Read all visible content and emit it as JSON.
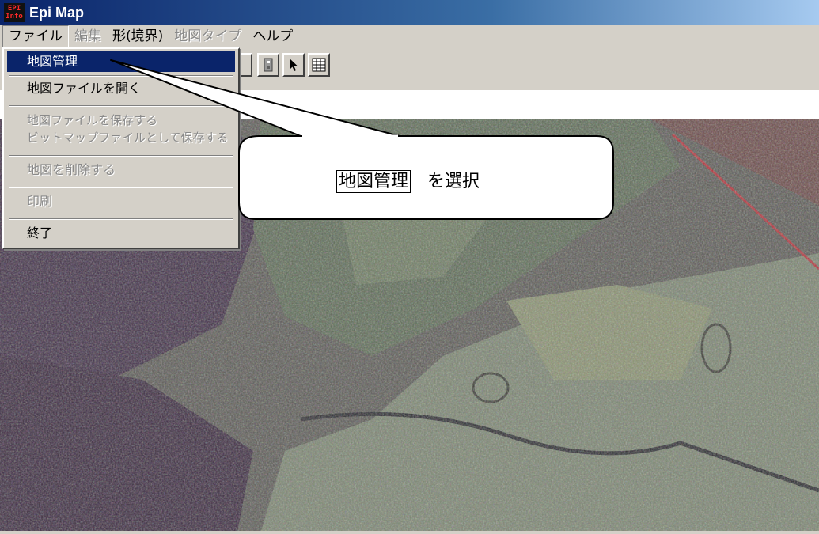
{
  "window": {
    "title": "Epi Map",
    "icon": {
      "name": "epi-info-icon",
      "line1": "EPI",
      "line2": "Info"
    }
  },
  "menubar": {
    "items": [
      {
        "label": "ファイル",
        "state": "open"
      },
      {
        "label": "編集",
        "state": "disabled"
      },
      {
        "label": "形(境界)",
        "state": "normal"
      },
      {
        "label": "地図タイプ",
        "state": "disabled"
      },
      {
        "label": "ヘルプ",
        "state": "normal"
      }
    ]
  },
  "file_menu": {
    "items": [
      {
        "label": "地図管理",
        "state": "highlighted"
      },
      {
        "label": "地図ファイルを開く",
        "state": "normal"
      },
      {
        "label": "地図ファイルを保存する",
        "state": "disabled"
      },
      {
        "label": "ビットマップファイルとして保存する",
        "state": "disabled"
      },
      {
        "label": "地図を削除する",
        "state": "disabled"
      },
      {
        "label": "印刷",
        "state": "disabled"
      },
      {
        "label": "終了",
        "state": "normal"
      }
    ]
  },
  "toolbar": {
    "buttons": [
      "pan-tool-icon",
      "zoom-icon",
      "pointer-arrow-icon",
      "table-grid-icon"
    ]
  },
  "callout": {
    "boxed_text": "地図管理",
    "suffix_text": "を選択"
  },
  "colors": {
    "titlebar_start": "#0a246a",
    "titlebar_end": "#a6caf0",
    "menu_highlight": "#0a246a",
    "window_bg": "#d4d0c8"
  }
}
